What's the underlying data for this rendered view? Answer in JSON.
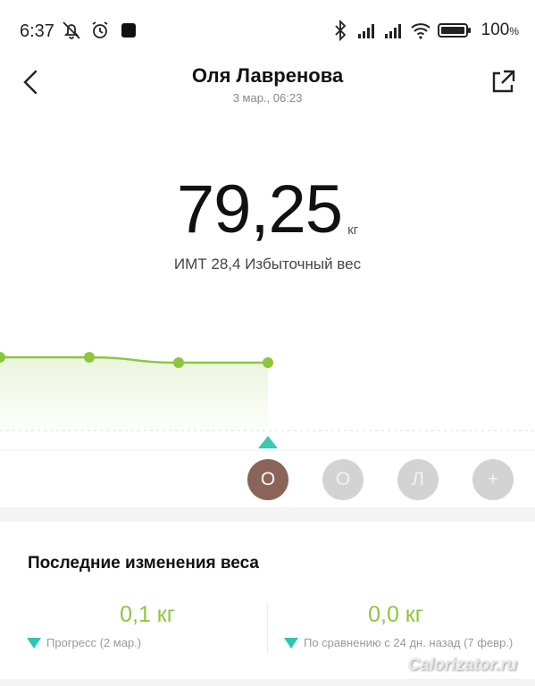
{
  "status_bar": {
    "time": "6:37",
    "battery_percent": "100",
    "battery_unit": "%",
    "icons": [
      "bell-muted-icon",
      "alarm-icon",
      "app-square-icon",
      "bluetooth-icon",
      "signal-icon",
      "signal-icon",
      "wifi-icon",
      "battery-icon"
    ]
  },
  "header": {
    "title": "Оля Лавренова",
    "subtitle": "3 мар., 06:23",
    "back_icon": "chevron-left-icon",
    "share_icon": "external-link-icon"
  },
  "measurement": {
    "weight": "79,25",
    "unit": "кг",
    "bmi_text": "ИМТ 28,4  Избыточный вес"
  },
  "chart_data": {
    "type": "line",
    "points": [
      0.0,
      0.0,
      0.1,
      0.1
    ],
    "color": "#8cc63f",
    "selected_marker_color": "#3cc7b0"
  },
  "users": [
    {
      "label": "О",
      "active": true
    },
    {
      "label": "О",
      "active": false
    },
    {
      "label": "Л",
      "active": false
    },
    {
      "label": "+",
      "active": false
    }
  ],
  "recent": {
    "title": "Последние изменения веса",
    "items": [
      {
        "value": "0,1 кг",
        "desc": "Прогресс (2 мар.)"
      },
      {
        "value": "0,0 кг",
        "desc": "По сравнению с 24 дн. назад (7 февр.)"
      }
    ]
  },
  "watermark": "Calorizator.ru",
  "colors": {
    "accent_green": "#8cc63f",
    "accent_teal": "#2ec4b6",
    "active_user": "#8a6458",
    "inactive_user": "#d3d3d3"
  }
}
